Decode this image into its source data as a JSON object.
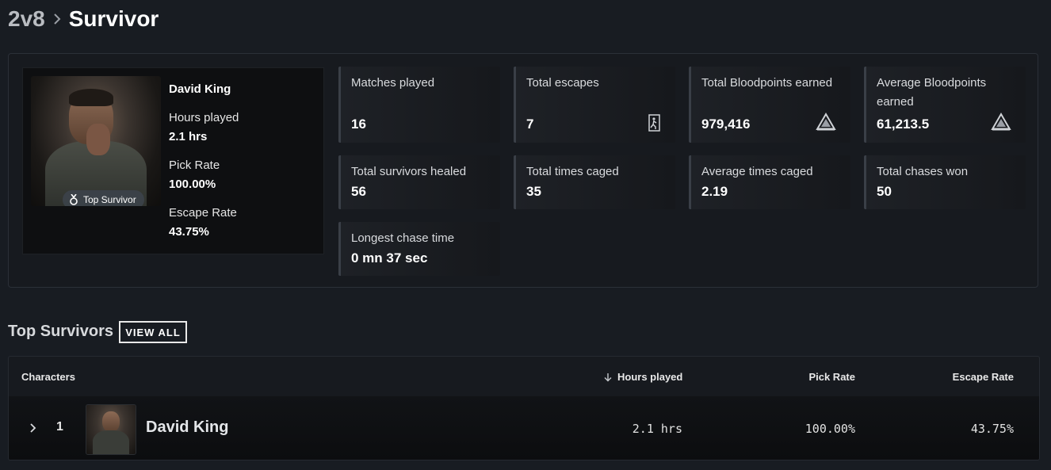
{
  "breadcrumb": {
    "mode": "2v8",
    "page": "Survivor"
  },
  "character": {
    "name": "David King",
    "badge": "Top Survivor",
    "hours_label": "Hours played",
    "hours_value": "2.1 hrs",
    "pick_label": "Pick Rate",
    "pick_value": "100.00%",
    "escape_label": "Escape Rate",
    "escape_value": "43.75%"
  },
  "stats": [
    {
      "label": "Matches played",
      "value": "16",
      "icon": ""
    },
    {
      "label": "Total escapes",
      "value": "7",
      "icon": "exit-door-icon"
    },
    {
      "label": "Total Bloodpoints earned",
      "value": "979,416",
      "icon": "bloodpoints-icon"
    },
    {
      "label": "Average Bloodpoints earned",
      "value": "61,213.5",
      "icon": "bloodpoints-icon"
    },
    {
      "label": "Total survivors healed",
      "value": "56",
      "icon": ""
    },
    {
      "label": "Total times caged",
      "value": "35",
      "icon": ""
    },
    {
      "label": "Average times caged",
      "value": "2.19",
      "icon": ""
    },
    {
      "label": "Total chases won",
      "value": "50",
      "icon": ""
    },
    {
      "label": "Longest chase time",
      "value": "0 mn 37 sec",
      "icon": ""
    }
  ],
  "top_survivors": {
    "title": "Top Survivors",
    "view_all": "VIEW ALL",
    "columns": {
      "characters": "Characters",
      "hours": "Hours played",
      "pick": "Pick Rate",
      "escape": "Escape Rate"
    },
    "sort_column": "hours",
    "rows": [
      {
        "rank": "1",
        "name": "David King",
        "hours": "2.1 hrs",
        "pick": "100.00%",
        "escape": "43.75%"
      }
    ]
  },
  "colors": {
    "background": "#181c22",
    "card": "#0e0f11",
    "text": "#ffffff"
  }
}
